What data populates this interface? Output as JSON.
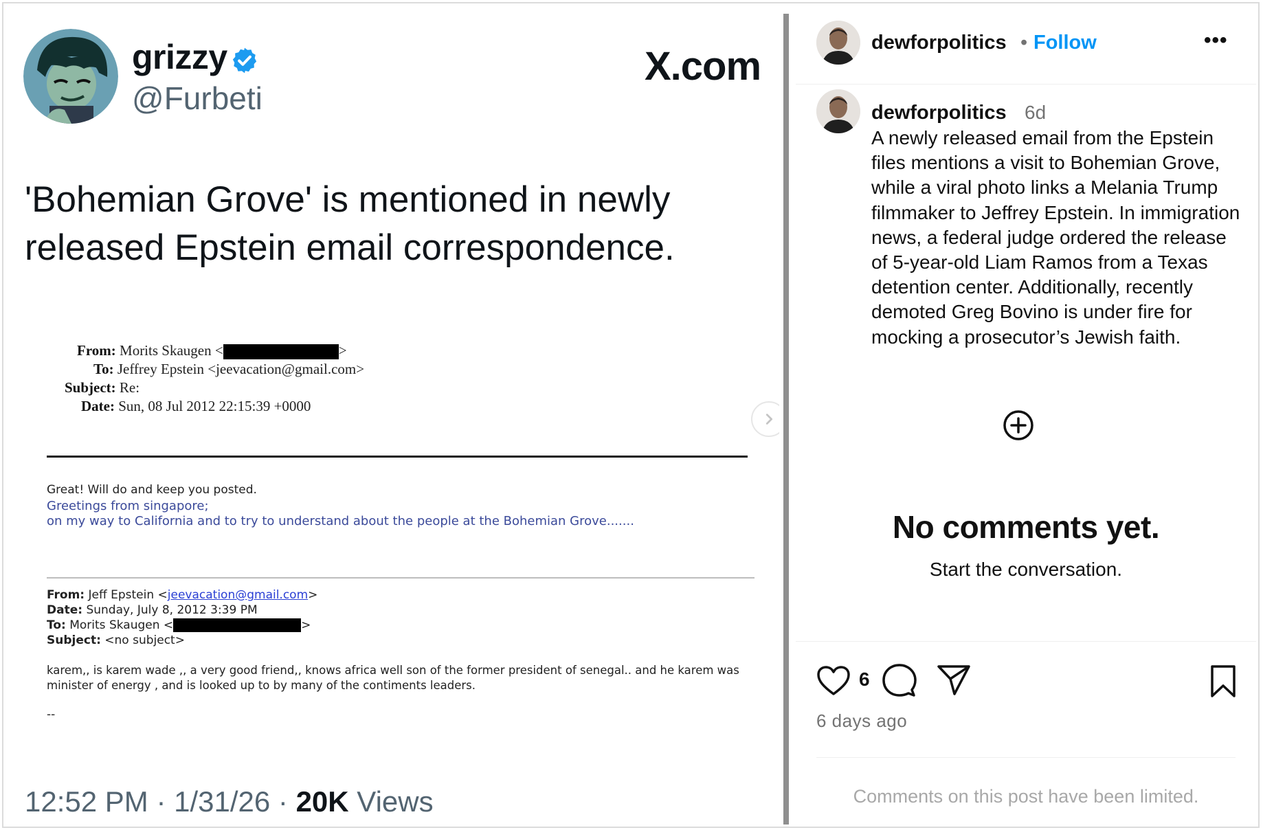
{
  "tweet": {
    "author_name": "grizzy",
    "handle": "@Furbeti",
    "site_logo": "X.com",
    "text": "'Bohemian Grove' is mentioned in newly released Epstein email correspondence.",
    "time": "12:52 PM",
    "sep1": " · ",
    "date": "1/31/26",
    "sep2": " · ",
    "views_count": "20K",
    "views_label": " Views",
    "icons": {
      "verified": "verified-badge-icon",
      "next": "chevron-right-icon"
    },
    "colors": {
      "verified": "#1d9bf0",
      "handle": "#536471"
    }
  },
  "email": {
    "header1": {
      "from_label": "From:",
      "from_value": "Morits Skaugen <",
      "from_end": ">",
      "to_label": "To:",
      "to_value": "Jeffrey Epstein <jeevacation@gmail.com>",
      "subject_label": "Subject:",
      "subject_value": "Re:",
      "date_label": "Date:",
      "date_value": "Sun, 08 Jul 2012 22:15:39 +0000"
    },
    "reply_line": "Great! Will do and keep you posted.",
    "quote_line1": "Greetings from singapore;",
    "quote_line2": "on my way to California and to try to understand about the people at the Bohemian Grove.......",
    "header2": {
      "from_label": "From:",
      "from_name": " Jeff Epstein <",
      "from_email": "jeevacation@gmail.com",
      "from_end": ">",
      "date_label": "Date:",
      "date_value": " Sunday, July 8, 2012 3:39 PM",
      "to_label": "To:",
      "to_value": " Morits Skaugen <",
      "to_end": ">",
      "subject_label": "Subject:",
      "subject_value": " <no subject>"
    },
    "body_line1": "karem,, is karem wade ,, a very good friend,, knows africa well son of the former president of senegal.. and he karem was",
    "body_line2": "minister of energy , and is looked up to by many of the contiments leaders.",
    "signature": "--"
  },
  "instagram": {
    "username": "dewforpolitics",
    "dot": "•",
    "follow_label": "Follow",
    "more_label": "•••",
    "caption_username": "dewforpolitics",
    "caption_age": "6d",
    "caption": "A newly released email from the Epstein files mentions a visit to Bohemian Grove, while a viral photo links a Melania Trump filmmaker to Jeffrey Epstein. In immigration news, a federal judge ordered the release of 5-year-old Liam Ramos from a Texas detention center. Additionally, recently demoted Greg Bovino is under fire for mocking a prosecutor’s Jewish faith.",
    "no_comments": "No comments yet.",
    "start_conversation": "Start the conversation.",
    "like_count": "6",
    "time_ago": "6 days ago",
    "comments_limited": "Comments on this post have been limited.",
    "icons": {
      "add": "add-circle-icon",
      "like": "heart-icon",
      "comment": "comment-bubble-icon",
      "share": "paper-plane-icon",
      "save": "bookmark-icon"
    },
    "colors": {
      "follow": "#0095f6",
      "muted": "#737373"
    }
  }
}
